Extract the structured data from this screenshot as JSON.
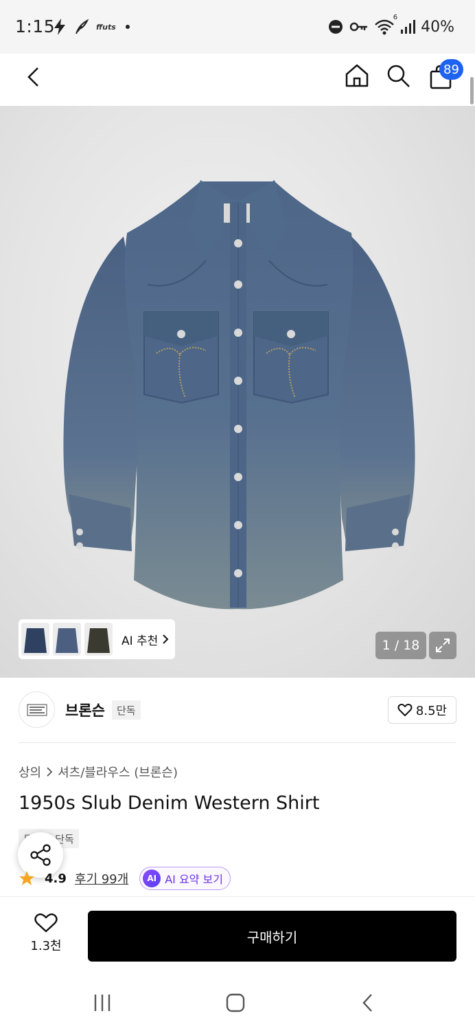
{
  "status_bar": {
    "time": "1:15",
    "battery": "40%",
    "app_label": "ffuts",
    "wifi_label": "6",
    "icons": [
      "lightning-icon",
      "feather-icon",
      "ffuts-icon",
      "dot-icon",
      "do-not-disturb-icon",
      "key-icon",
      "wifi-icon",
      "signal-icon"
    ]
  },
  "app_bar": {
    "cart_count": "89",
    "icons": [
      "back-icon",
      "home-icon",
      "search-icon",
      "cart-icon"
    ]
  },
  "gallery": {
    "ai_recommend_label": "AI 추천",
    "counter": "1 / 18",
    "thumbnails": [
      {
        "name": "thumb-denim-dark",
        "color": "#2e4160"
      },
      {
        "name": "thumb-denim-light",
        "color": "#4c5f80"
      },
      {
        "name": "thumb-jacket-olive",
        "color": "#3a3a30"
      }
    ]
  },
  "brand": {
    "name": "브론슨",
    "tag": "단독",
    "likes": "8.5만"
  },
  "product": {
    "breadcrumb": [
      "상의",
      "셔츠/블라우스 (브론슨)"
    ],
    "title": "1950s Slub Denim Western Shirt",
    "tag": "무신사 단독",
    "rating": "4.9",
    "reviews": "후기 99개",
    "ai_summary": "AI 요약 보기",
    "ai_chip": "AI"
  },
  "purchase": {
    "wish_count": "1.3천",
    "buy_label": "구매하기"
  },
  "colors": {
    "badge": "#1e63f0",
    "buy_button": "#000000",
    "star": "#f5a623",
    "ai_accent": "#6a35e0"
  }
}
